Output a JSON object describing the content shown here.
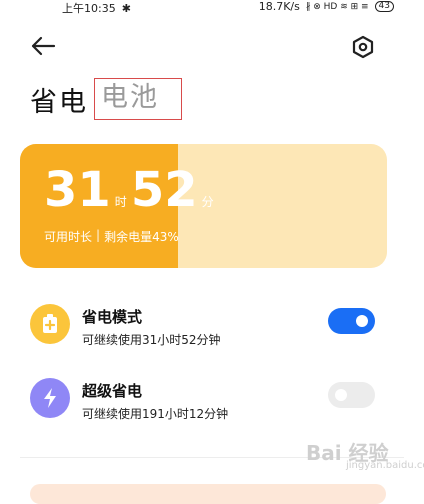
{
  "status_bar": {
    "time": "上午10:35",
    "network_speed": "18.7K/s",
    "status_icons": "∦ ⊗ HD ≋ ⊞ ≡",
    "battery": "43"
  },
  "header": {
    "back_icon": "arrow-left-icon",
    "settings_icon": "hexagon-gear-icon"
  },
  "tabs": {
    "active": "省电",
    "inactive": "电池"
  },
  "battery_card": {
    "hours": "31",
    "hours_unit": "时",
    "minutes": "52",
    "minutes_unit": "分",
    "usage_label": "可用时长",
    "divider": "|",
    "remaining_label": "剩余电量43%",
    "fill_fraction": 0.43,
    "colors": {
      "fill": "#f7ad22",
      "track": "#fde7b6"
    }
  },
  "modes": [
    {
      "title": "省电模式",
      "desc": "可继续使用31小时52分钟",
      "icon": "battery-plus-icon",
      "icon_bg": "#fbc53b",
      "enabled": true
    },
    {
      "title": "超级省电",
      "desc": "可继续使用191小时12分钟",
      "icon": "lightning-icon",
      "icon_bg": "#8f87f6",
      "enabled": false
    }
  ],
  "watermark": {
    "main": "Bai 经验",
    "sub": "jingyan.baidu.com"
  },
  "colors": {
    "toggle_on": "#1a6ef5",
    "toggle_off": "#ececec",
    "highlight_box": "#d84b4b"
  }
}
